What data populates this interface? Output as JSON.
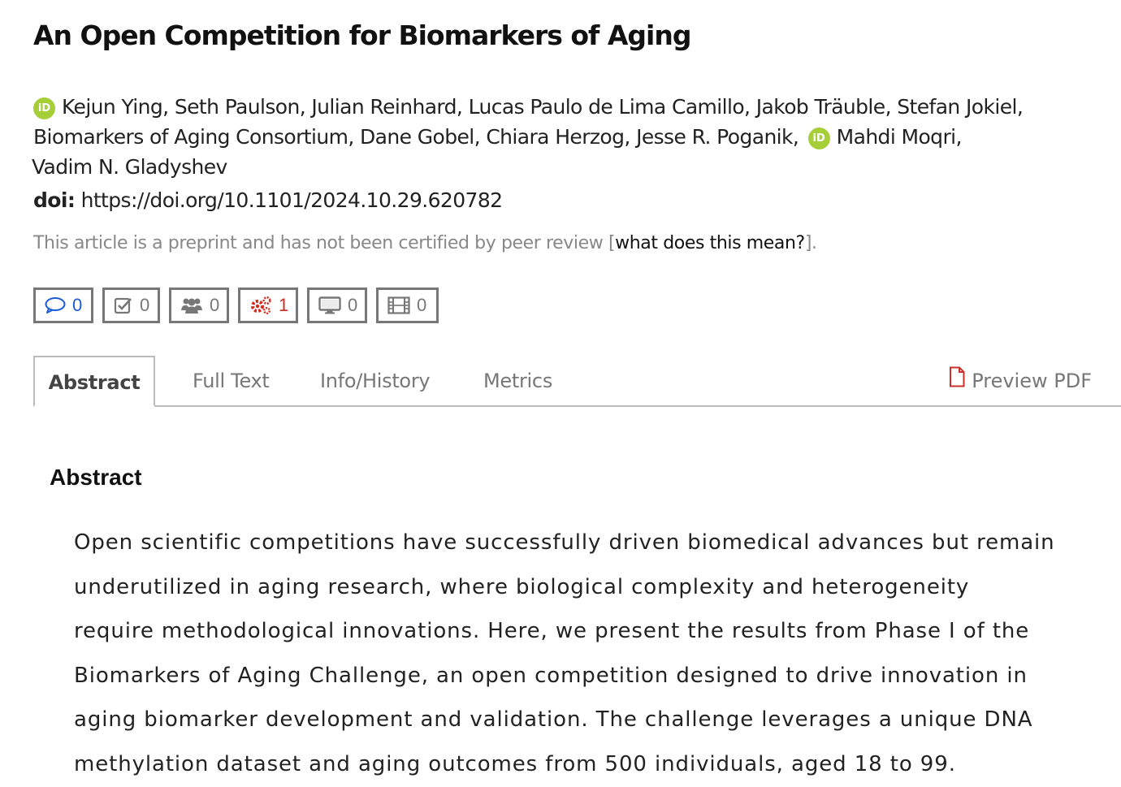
{
  "article": {
    "title": "An Open Competition for Biomarkers of Aging",
    "authors": {
      "line1": "Kejun Ying, Seth Paulson, Julian Reinhard, Lucas Paulo de Lima Camillo, Jakob Träuble, Stefan Jokiel,",
      "line2a": "Biomarkers of Aging Consortium, Dane Gobel, Chiara Herzog, Jesse R. Poganik,",
      "line2b": "Mahdi Moqri,",
      "line3": "Vadim N. Gladyshev",
      "orcid_label": "iD"
    },
    "doi_label": "doi:",
    "doi_value": "https://doi.org/10.1101/2024.10.29.620782",
    "preprint_notice": "This article is a preprint and has not been certified by peer review [",
    "preprint_link": "what does this mean?",
    "preprint_end": "]."
  },
  "counters": [
    {
      "icon": "comment-icon",
      "value": "0",
      "color": "#1a5bd6"
    },
    {
      "icon": "checklist-icon",
      "value": "0",
      "color": "#777777"
    },
    {
      "icon": "users-icon",
      "value": "0",
      "color": "#777777"
    },
    {
      "icon": "gears-icon",
      "value": "1",
      "color": "#d42a1e"
    },
    {
      "icon": "monitor-icon",
      "value": "0",
      "color": "#777777"
    },
    {
      "icon": "film-icon",
      "value": "0",
      "color": "#777777"
    }
  ],
  "tabs": [
    {
      "label": "Abstract"
    },
    {
      "label": "Full Text"
    },
    {
      "label": "Info/History"
    },
    {
      "label": "Metrics"
    }
  ],
  "pdf_label": "Preview PDF",
  "abstract": {
    "heading": "Abstract",
    "lines": [
      "Open scientific competitions have successfully driven biomedical advances but remain",
      "underutilized in aging research, where biological complexity and heterogeneity",
      "require methodological innovations. Here, we present the results from Phase I of the",
      "Biomarkers of Aging Challenge, an open competition designed to drive innovation in",
      "aging biomarker development and validation. The challenge leverages a unique DNA",
      "methylation dataset and aging outcomes from 500 individuals, aged 18 to 99."
    ]
  }
}
